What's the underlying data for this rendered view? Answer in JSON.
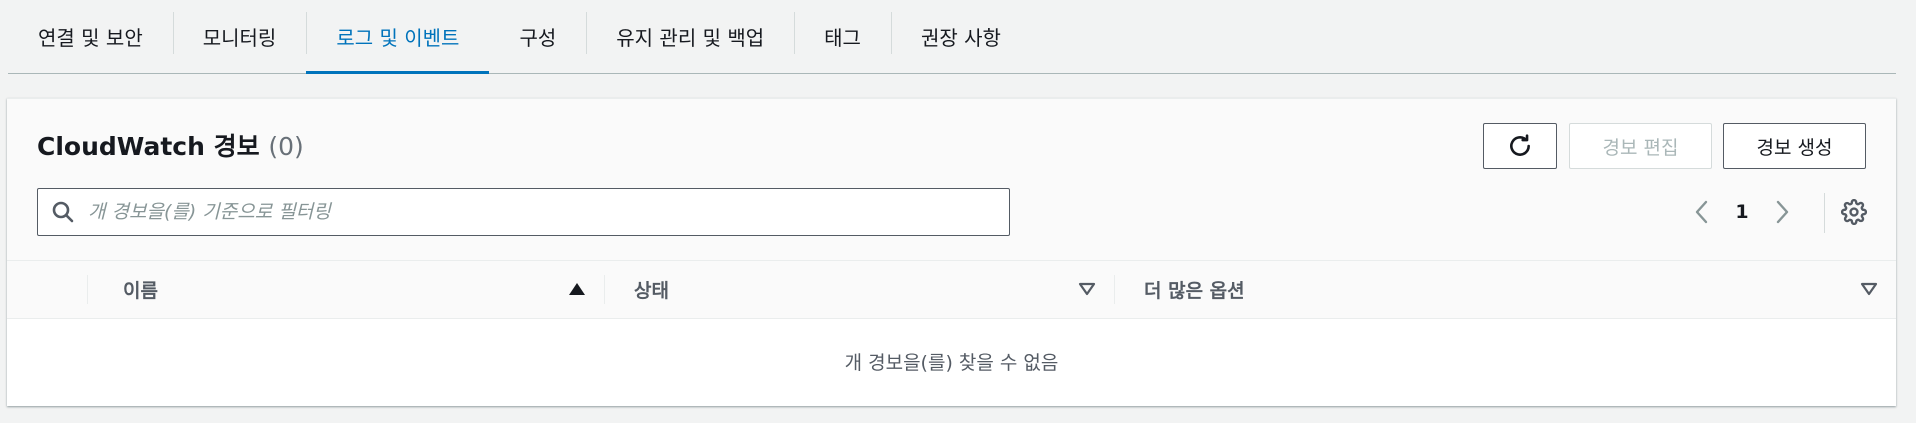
{
  "tabs": [
    {
      "label": "연결 및 보안",
      "active": false
    },
    {
      "label": "모니터링",
      "active": false
    },
    {
      "label": "로그 및 이벤트",
      "active": true
    },
    {
      "label": "구성",
      "active": false
    },
    {
      "label": "유지 관리 및 백업",
      "active": false
    },
    {
      "label": "태그",
      "active": false
    },
    {
      "label": "권장 사항",
      "active": false
    }
  ],
  "panel": {
    "title": "CloudWatch 경보",
    "count": "(0)",
    "buttons": {
      "refresh_icon": "refresh-icon",
      "edit_label": "경보 편집",
      "edit_disabled": true,
      "create_label": "경보 생성"
    },
    "search": {
      "placeholder": "개 경보을(를) 기준으로 필터링",
      "value": "",
      "icon": "search-icon"
    },
    "pagination": {
      "current_page": "1",
      "prev_icon": "chevron-left-icon",
      "next_icon": "chevron-right-icon"
    },
    "settings_icon": "gear-icon"
  },
  "table": {
    "columns": [
      {
        "label": "이름",
        "sort": "ascending"
      },
      {
        "label": "상태",
        "sort": "none"
      },
      {
        "label": "더 많은 옵션",
        "sort": "none"
      }
    ],
    "rows": [],
    "empty_message": "개 경보을(를) 찾을 수 없음"
  },
  "colors": {
    "accent": "#0073bb",
    "page_background": "#f2f3f3",
    "text": "#16191f",
    "muted_text": "#545b64",
    "disabled": "#aab7b8"
  }
}
